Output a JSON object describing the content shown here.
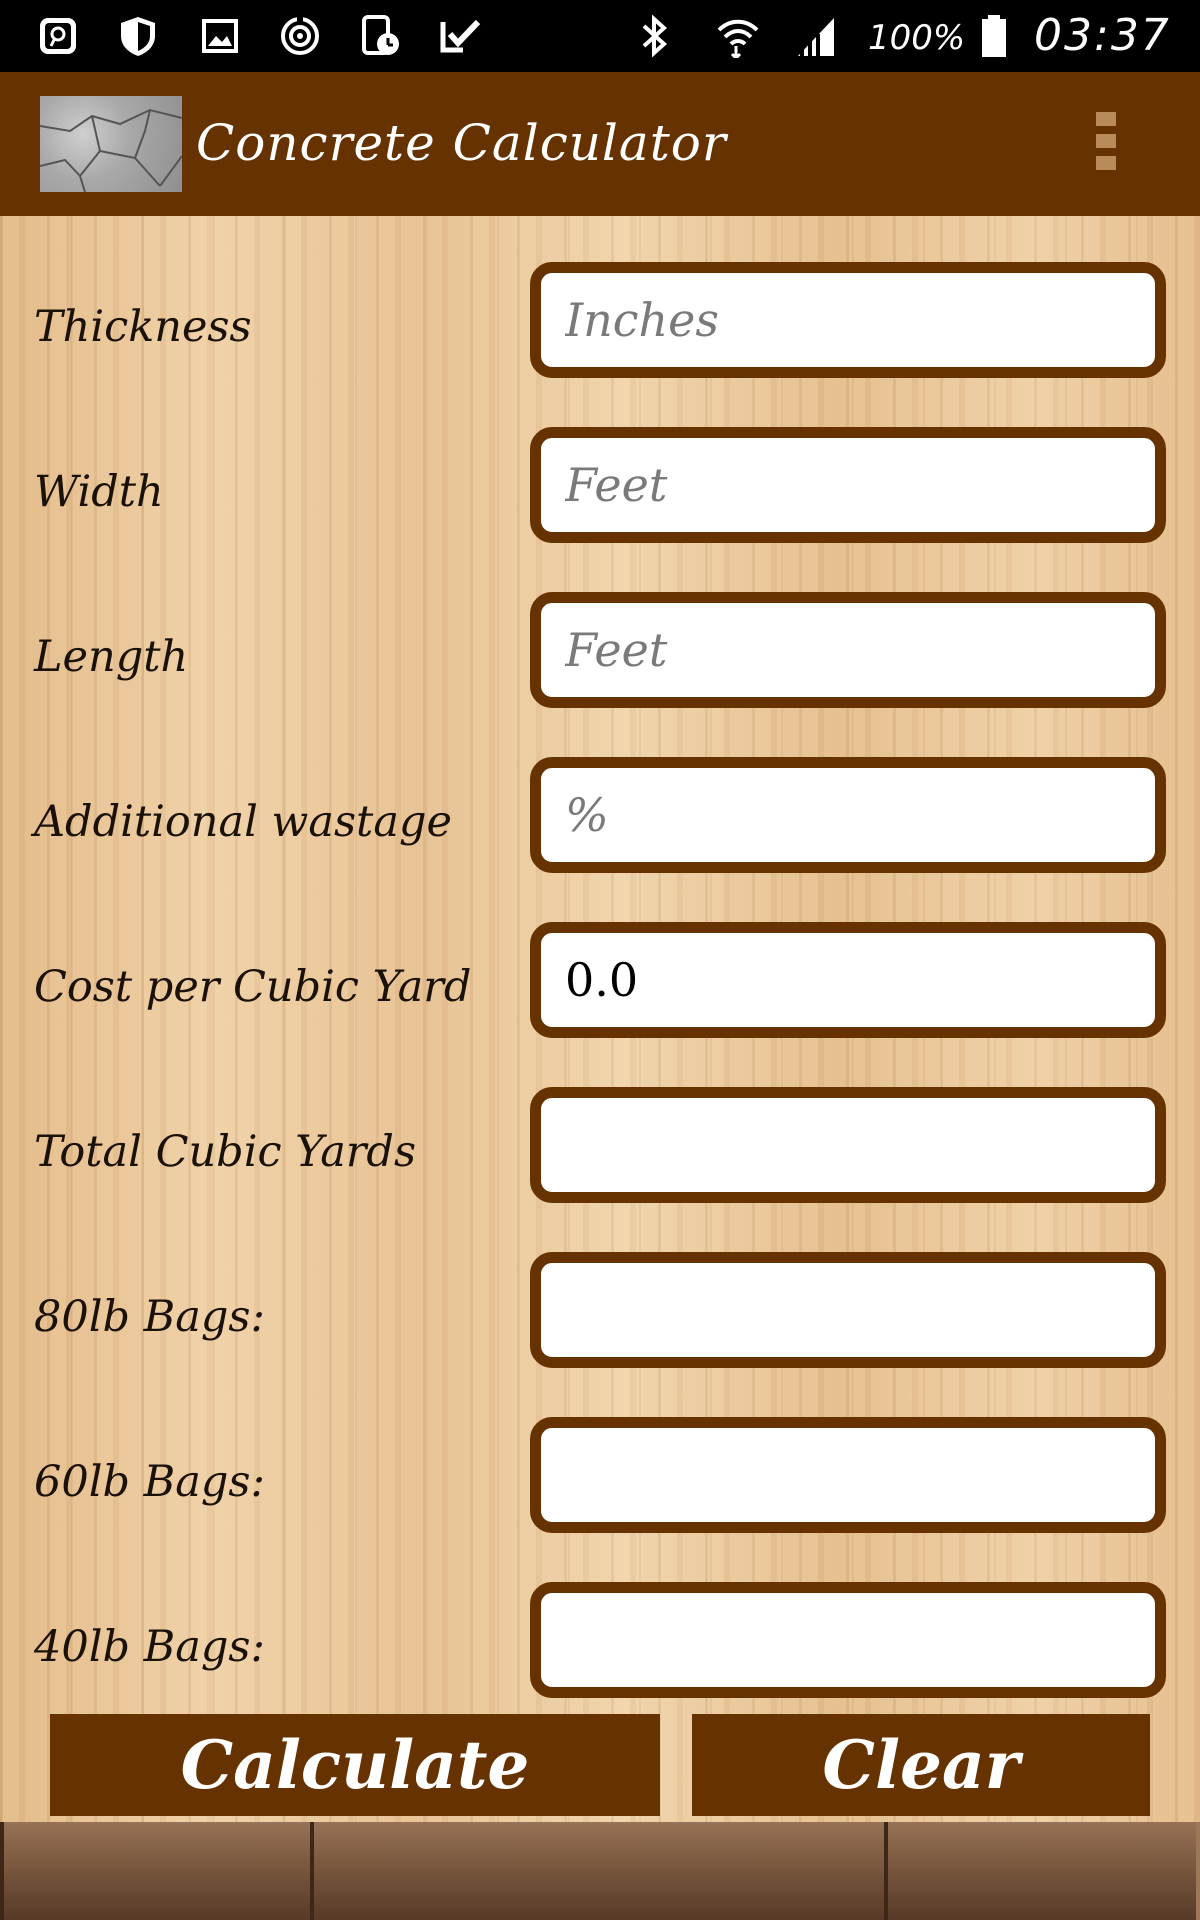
{
  "status_bar": {
    "battery": "100%",
    "time": "03:37",
    "icons": [
      "search-app-icon",
      "shield-icon",
      "gallery-icon",
      "sync-icon",
      "tablet-clock-icon",
      "check-icon",
      "bluetooth-icon",
      "wifi-icon",
      "signal-icon",
      "battery-icon"
    ]
  },
  "app_bar": {
    "title": "Concrete Calculator",
    "overflow_icon": "more-vert-icon",
    "logo": "cracked-concrete-logo"
  },
  "form": {
    "fields": [
      {
        "label": "Thickness",
        "placeholder": "Inches",
        "value": ""
      },
      {
        "label": "Width",
        "placeholder": "Feet",
        "value": ""
      },
      {
        "label": "Length",
        "placeholder": "Feet",
        "value": ""
      },
      {
        "label": "Additional wastage",
        "placeholder": "%",
        "value": ""
      },
      {
        "label": "Cost per Cubic Yard",
        "placeholder": "",
        "value": "0.0"
      },
      {
        "label": "Total Cubic Yards",
        "placeholder": "",
        "value": ""
      },
      {
        "label": "80lb Bags:",
        "placeholder": "",
        "value": ""
      },
      {
        "label": "60lb Bags:",
        "placeholder": "",
        "value": ""
      },
      {
        "label": "40lb Bags:",
        "placeholder": "",
        "value": ""
      }
    ]
  },
  "buttons": {
    "calculate_label": "Calculate",
    "clear_label": "Clear"
  },
  "colors": {
    "accent": "#663300",
    "wood": "#e8c393",
    "input_bg": "#ffffff",
    "placeholder": "#7a7a7a"
  }
}
